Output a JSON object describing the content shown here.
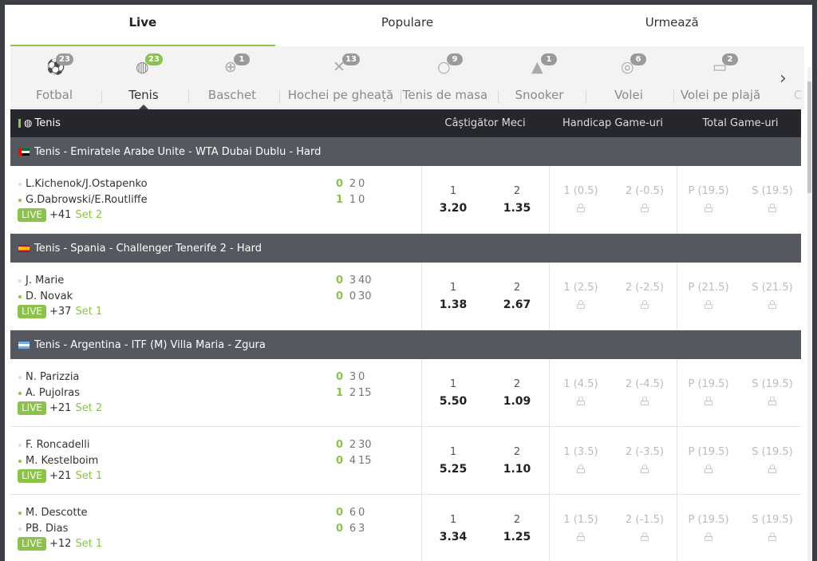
{
  "top_tabs": [
    {
      "label": "Live",
      "active": true
    },
    {
      "label": "Populare",
      "active": false
    },
    {
      "label": "Urmează",
      "active": false
    }
  ],
  "sports": [
    {
      "label": "Fotbal",
      "count": "23",
      "icon": "soccer-ball-icon",
      "glyph": "⚽"
    },
    {
      "label": "Tenis",
      "count": "23",
      "icon": "tennis-ball-icon",
      "glyph": "◍"
    },
    {
      "label": "Baschet",
      "count": "1",
      "icon": "basketball-icon",
      "glyph": "⊕"
    },
    {
      "label": "Hochei pe gheață",
      "count": "13",
      "icon": "hockey-sticks-icon",
      "glyph": "✕"
    },
    {
      "label": "Tenis de masa",
      "count": "9",
      "icon": "ping-pong-icon",
      "glyph": "○"
    },
    {
      "label": "Snooker",
      "count": "1",
      "icon": "snooker-balls-icon",
      "glyph": "▲"
    },
    {
      "label": "Volei",
      "count": "6",
      "icon": "volleyball-icon",
      "glyph": "◎"
    },
    {
      "label": "Volei pe plajă",
      "count": "2",
      "icon": "beach-volleyball-icon",
      "glyph": "▭"
    }
  ],
  "sports_overflow": "C",
  "table_header": {
    "sport": "Tenis",
    "col1": "Câștigător Meci",
    "col2": "Handicap Game-uri",
    "col3": "Total Game-uri"
  },
  "live_label": "LIVE",
  "leagues": [
    {
      "title": "Tenis - Emiratele Arabe Unite - WTA Dubai Dublu - Hard",
      "flag": "ae",
      "matches": [
        {
          "p1": "L.Kichenok/J.Ostapenko",
          "p2": "G.Dabrowski/E.Routliffe",
          "serve": 2,
          "s1": {
            "sets": "0",
            "games": "2",
            "points": "0"
          },
          "s2": {
            "sets": "1",
            "games": "1",
            "points": "0"
          },
          "more": "+41",
          "set": "Set 2",
          "w1": {
            "label": "1",
            "value": "3.20"
          },
          "w2": {
            "label": "2",
            "value": "1.35"
          },
          "h1": "1 (0.5)",
          "h2": "2 (-0.5)",
          "t1": "P (19.5)",
          "t2": "S (19.5)"
        }
      ]
    },
    {
      "title": "Tenis - Spania - Challenger Tenerife 2 - Hard",
      "flag": "es",
      "matches": [
        {
          "p1": "J. Marie",
          "p2": "D. Novak",
          "serve": 2,
          "s1": {
            "sets": "0",
            "games": "3",
            "points": "40"
          },
          "s2": {
            "sets": "0",
            "games": "0",
            "points": "30"
          },
          "more": "+37",
          "set": "Set 1",
          "w1": {
            "label": "1",
            "value": "1.38"
          },
          "w2": {
            "label": "2",
            "value": "2.67"
          },
          "h1": "1 (2.5)",
          "h2": "2 (-2.5)",
          "t1": "P (21.5)",
          "t2": "S (21.5)"
        }
      ]
    },
    {
      "title": "Tenis - Argentina - ITF (M) Villa Maria - Zgura",
      "flag": "ar",
      "matches": [
        {
          "p1": "N. Parizzia",
          "p2": "A. Pujolras",
          "serve": 2,
          "s1": {
            "sets": "0",
            "games": "3",
            "points": "0"
          },
          "s2": {
            "sets": "1",
            "games": "2",
            "points": "15"
          },
          "more": "+21",
          "set": "Set 2",
          "w1": {
            "label": "1",
            "value": "5.50"
          },
          "w2": {
            "label": "2",
            "value": "1.09"
          },
          "h1": "1 (4.5)",
          "h2": "2 (-4.5)",
          "t1": "P (19.5)",
          "t2": "S (19.5)"
        },
        {
          "p1": "F. Roncadelli",
          "p2": "M. Kestelboim",
          "serve": 2,
          "s1": {
            "sets": "0",
            "games": "2",
            "points": "30"
          },
          "s2": {
            "sets": "0",
            "games": "4",
            "points": "15"
          },
          "more": "+21",
          "set": "Set 1",
          "w1": {
            "label": "1",
            "value": "5.25"
          },
          "w2": {
            "label": "2",
            "value": "1.10"
          },
          "h1": "1 (3.5)",
          "h2": "2 (-3.5)",
          "t1": "P (19.5)",
          "t2": "S (19.5)"
        },
        {
          "p1": "M. Descotte",
          "p2": "PB. Dias",
          "serve": 1,
          "s1": {
            "sets": "0",
            "games": "6",
            "points": "0"
          },
          "s2": {
            "sets": "0",
            "games": "6",
            "points": "3"
          },
          "more": "+12",
          "set": "Set 1",
          "w1": {
            "label": "1",
            "value": "3.34"
          },
          "w2": {
            "label": "2",
            "value": "1.25"
          },
          "h1": "1 (1.5)",
          "h2": "2 (-1.5)",
          "t1": "P (19.5)",
          "t2": "S (19.5)"
        }
      ]
    }
  ],
  "colors": {
    "accent": "#8bc34a",
    "header_dark": "#25272c",
    "league_bg": "#55585f"
  }
}
